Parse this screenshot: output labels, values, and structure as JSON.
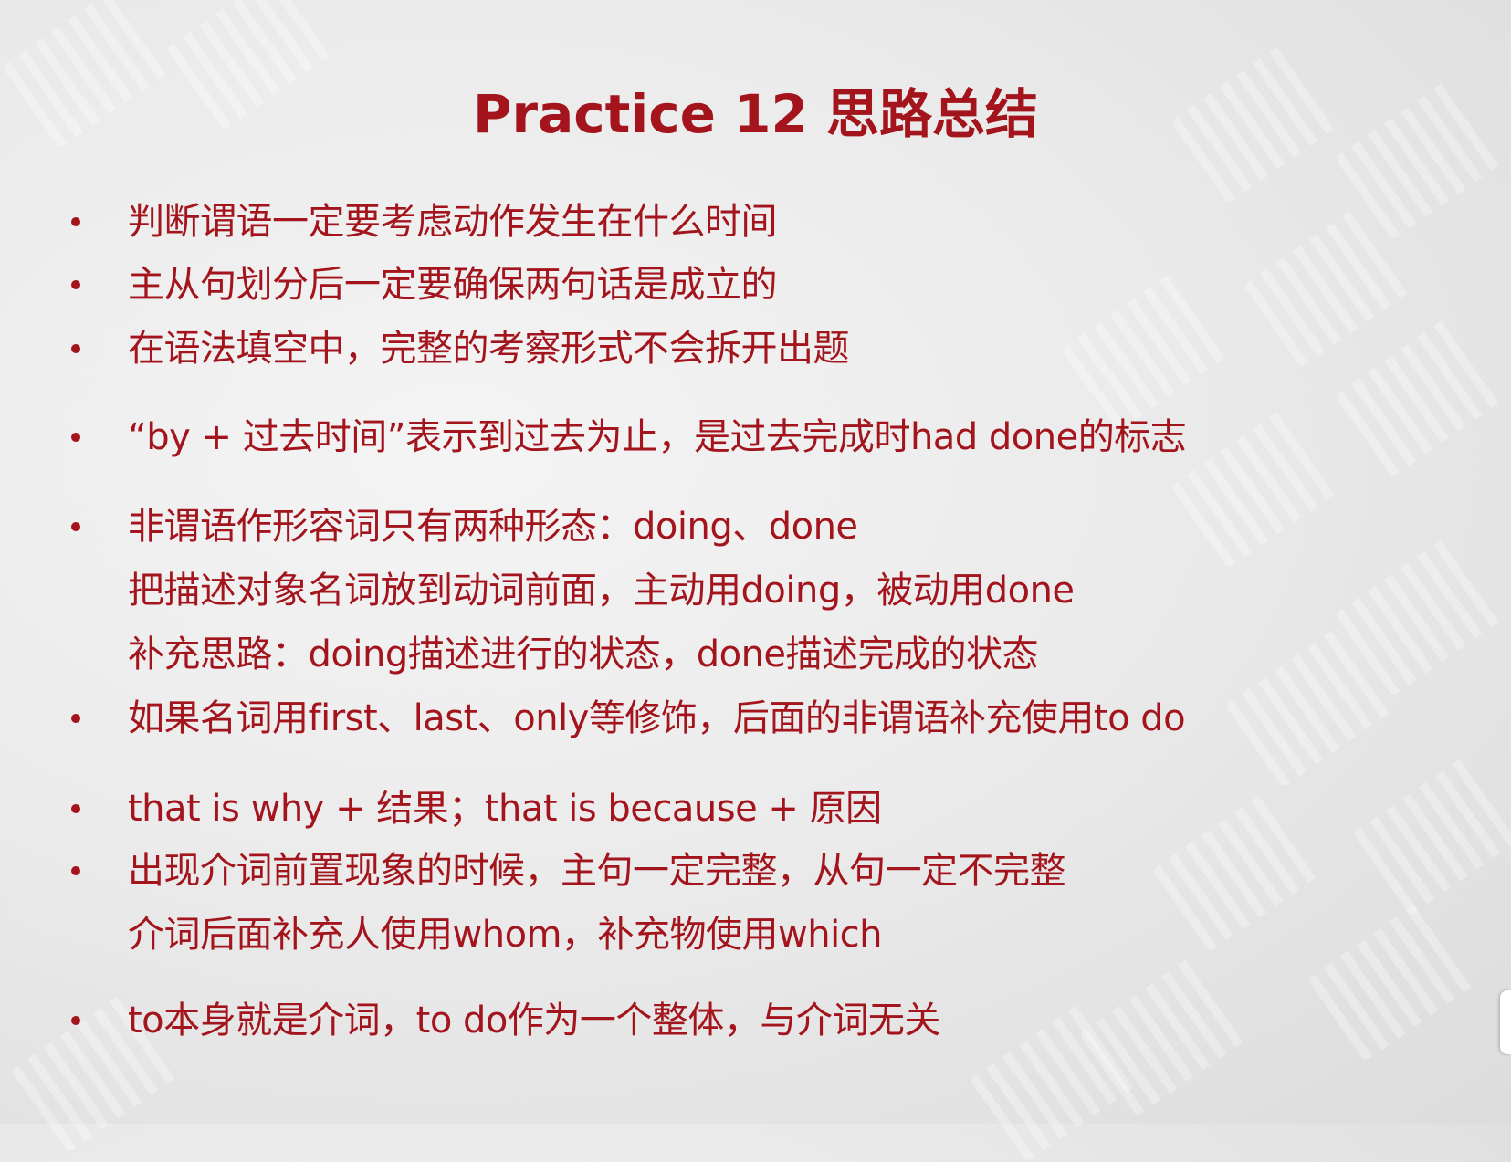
{
  "slide": {
    "title": "Practice 12 思路总结",
    "lines": [
      "判断谓语一定要考虑动作发生在什么时间",
      "主从句划分后一定要确保两句话是成立的",
      "在语法填空中，完整的考察形式不会拆开出题",
      "“by + 过去时间”表示到过去为止，是过去完成时had done的标志",
      "非谓语作形容词只有两种形态：doing、done",
      "把描述对象名词放到动词前面，主动用doing，被动用done",
      "补充思路：doing描述进行的状态，done描述完成的状态",
      "如果名词用first、last、only等修饰，后面的非谓语补充使用to do",
      "that is why + 结果；that is because + 原因",
      "出现介词前置现象的时候，主句一定完整，从句一定不完整",
      "介词后面补充人使用whom，补充物使用which",
      "to本身就是介词，to do作为一个整体，与介词无关"
    ]
  },
  "colors": {
    "text": "#a3141c",
    "background": "#ececec"
  }
}
